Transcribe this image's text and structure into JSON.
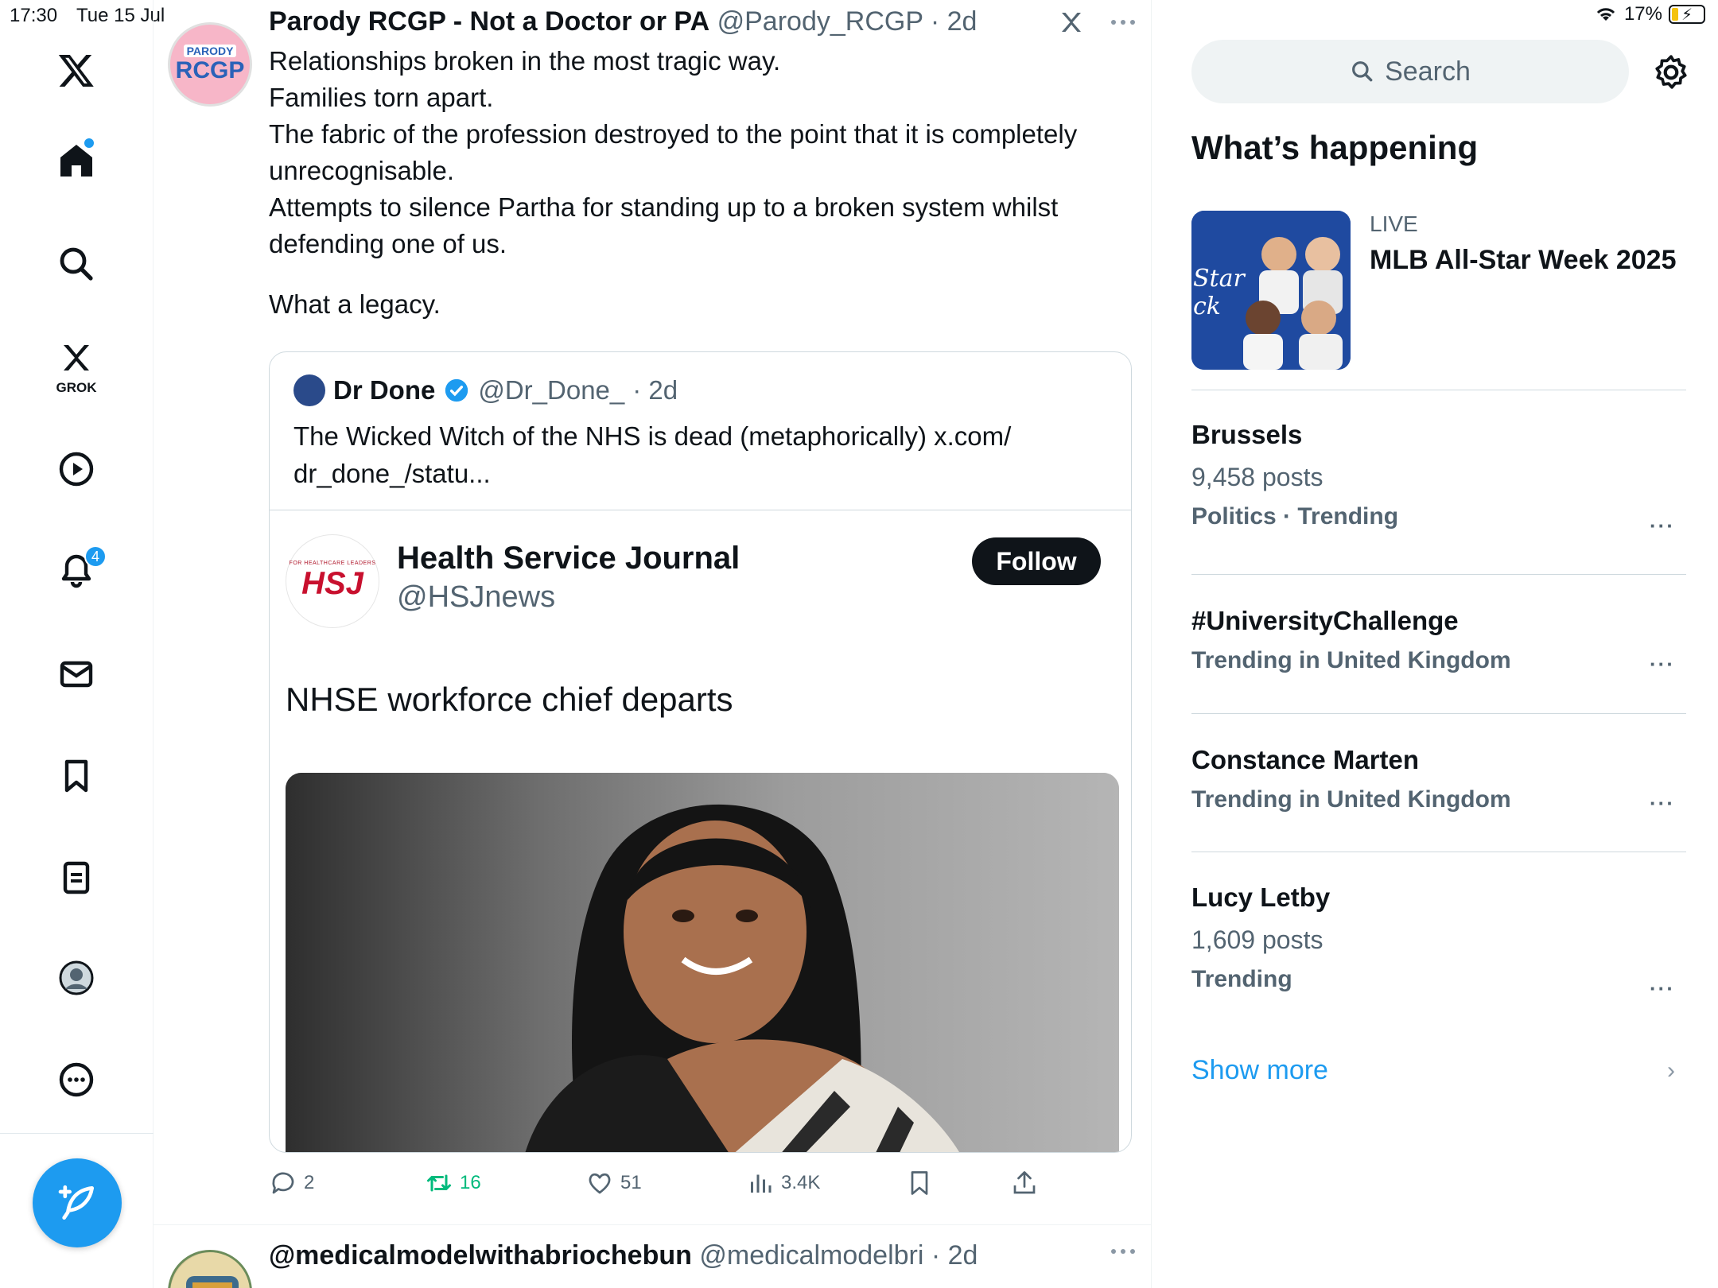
{
  "status": {
    "time": "17:30",
    "date": "Tue 15 Jul",
    "battery": "17%"
  },
  "nav": {
    "grok_label": "GROK",
    "notifications_badge": "4"
  },
  "tweet": {
    "author_name": "Parody RCGP - Not a Doctor or PA",
    "author_handle": "@Parody_RCGP",
    "time": "· 2d",
    "avatar_small": "PARODY",
    "avatar_big": "RCGP",
    "lines": [
      "Relationships broken in the most tragic way.",
      "Families torn apart.",
      "The fabric of the profession destroyed to the point that it is completely unrecognisable.",
      "Attempts to silence Partha for standing up to a broken system whilst defending one of us."
    ],
    "closing": "What a legacy.",
    "quote": {
      "name": "Dr Done",
      "handle": "@Dr_Done_",
      "time": "· 2d",
      "text": "The Wicked Witch of the NHS is dead (metaphorically) x.com/ dr_done_/statu...",
      "card": {
        "name": "Health Service Journal",
        "handle": "@HSJnews",
        "follow_label": "Follow",
        "logo_tagline": "FOR HEALTHCARE LEADERS",
        "logo_text": "HSJ",
        "headline": "NHSE workforce chief departs"
      }
    },
    "actions": {
      "replies": "2",
      "reposts": "16",
      "likes": "51",
      "views": "3.4K"
    }
  },
  "next_tweet": {
    "author_name": "@medicalmodelwithabriochebun",
    "author_handle": "@medicalmodelbri",
    "time": "· 2d"
  },
  "sidebar": {
    "search_placeholder": "Search",
    "section_title": "What’s happening",
    "featured": {
      "label": "LIVE",
      "title": "MLB All-Star Week 2025"
    },
    "trends": [
      {
        "title": "Brussels",
        "posts": "9,458 posts",
        "meta": "Politics · Trending"
      },
      {
        "title": "#UniversityChallenge",
        "posts": "",
        "meta": "Trending in United Kingdom"
      },
      {
        "title": "Constance Marten",
        "posts": "",
        "meta": "Trending in United Kingdom"
      },
      {
        "title": "Lucy Letby",
        "posts": "1,609 posts",
        "meta": "Trending"
      }
    ],
    "show_more": "Show more"
  },
  "colors": {
    "accent": "#1d9bf0",
    "repost": "#00ba7c",
    "muted": "#536471"
  }
}
